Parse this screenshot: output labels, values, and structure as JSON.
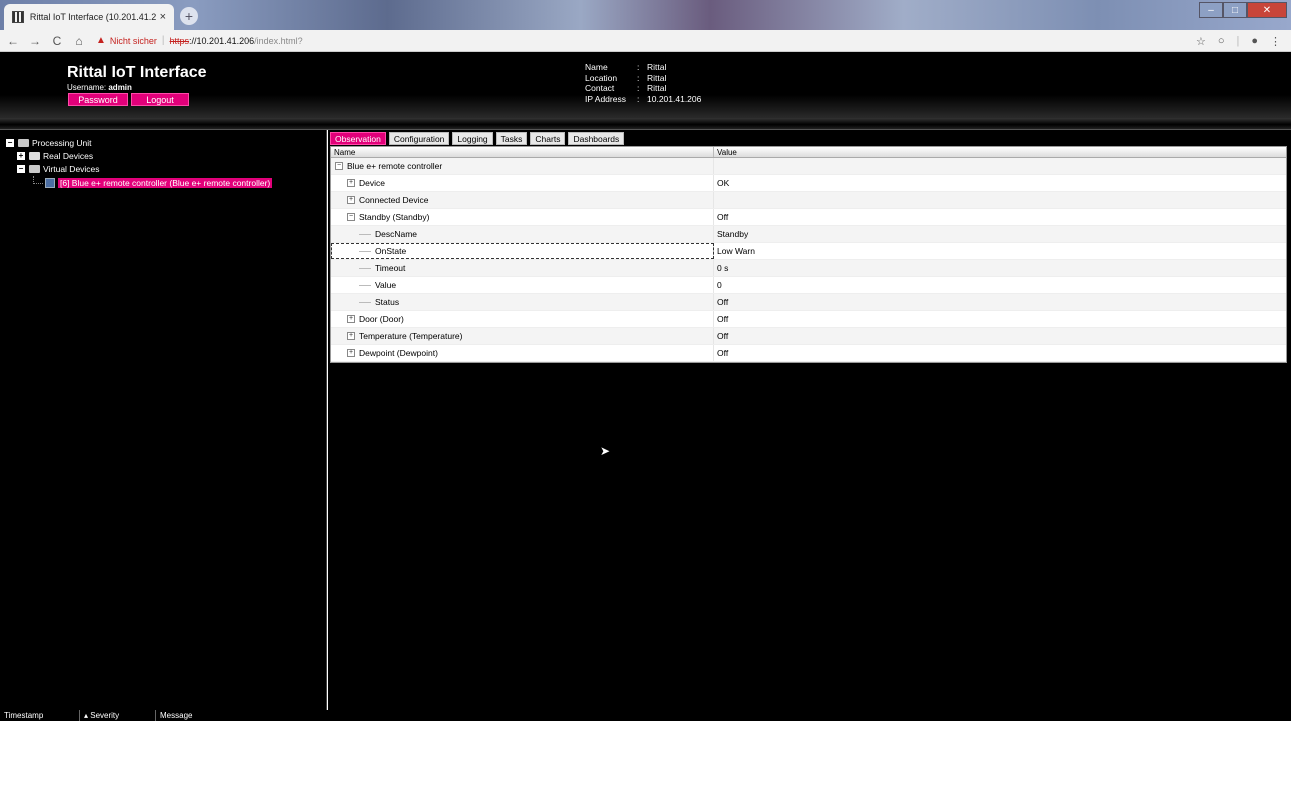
{
  "browser": {
    "tab_title": "Rittal IoT Interface (10.201.41.206)",
    "tab_close": "×",
    "new_tab": "+",
    "warning_text": "Nicht sicher",
    "url_scheme": "https",
    "url_host": "://10.201.41.206",
    "url_path": "/index.html?"
  },
  "header": {
    "title": "Rittal IoT Interface",
    "username_label": "Username:",
    "username": "admin",
    "password_btn": "Password",
    "logout_btn": "Logout",
    "info": [
      {
        "key": "Name",
        "value": "Rittal"
      },
      {
        "key": "Location",
        "value": "Rittal"
      },
      {
        "key": "Contact",
        "value": "Rittal"
      },
      {
        "key": "IP Address",
        "value": "10.201.41.206"
      }
    ]
  },
  "tree": {
    "processing_unit": "Processing Unit",
    "real_devices": "Real Devices",
    "virtual_devices": "Virtual Devices",
    "selected_device": "[6] Blue e+ remote controller (Blue e+ remote controller)"
  },
  "tabs": [
    "Observation",
    "Configuration",
    "Logging",
    "Tasks",
    "Charts",
    "Dashboards"
  ],
  "table": {
    "col_name": "Name",
    "col_value": "Value",
    "rows": [
      {
        "name": "Blue e+ remote controller",
        "value": ""
      },
      {
        "name": "Device",
        "value": "OK"
      },
      {
        "name": "Connected Device",
        "value": ""
      },
      {
        "name": "Standby (Standby)",
        "value": "Off"
      },
      {
        "name": "DescName",
        "value": "Standby"
      },
      {
        "name": "OnState",
        "value": "Low Warn"
      },
      {
        "name": "Timeout",
        "value": "0 s"
      },
      {
        "name": "Value",
        "value": "0"
      },
      {
        "name": "Status",
        "value": "Off"
      },
      {
        "name": "Door (Door)",
        "value": "Off"
      },
      {
        "name": "Temperature (Temperature)",
        "value": "Off"
      },
      {
        "name": "Dewpoint (Dewpoint)",
        "value": "Off"
      }
    ]
  },
  "log": {
    "col_timestamp": "Timestamp",
    "col_severity": "Severity",
    "col_message": "Message"
  }
}
